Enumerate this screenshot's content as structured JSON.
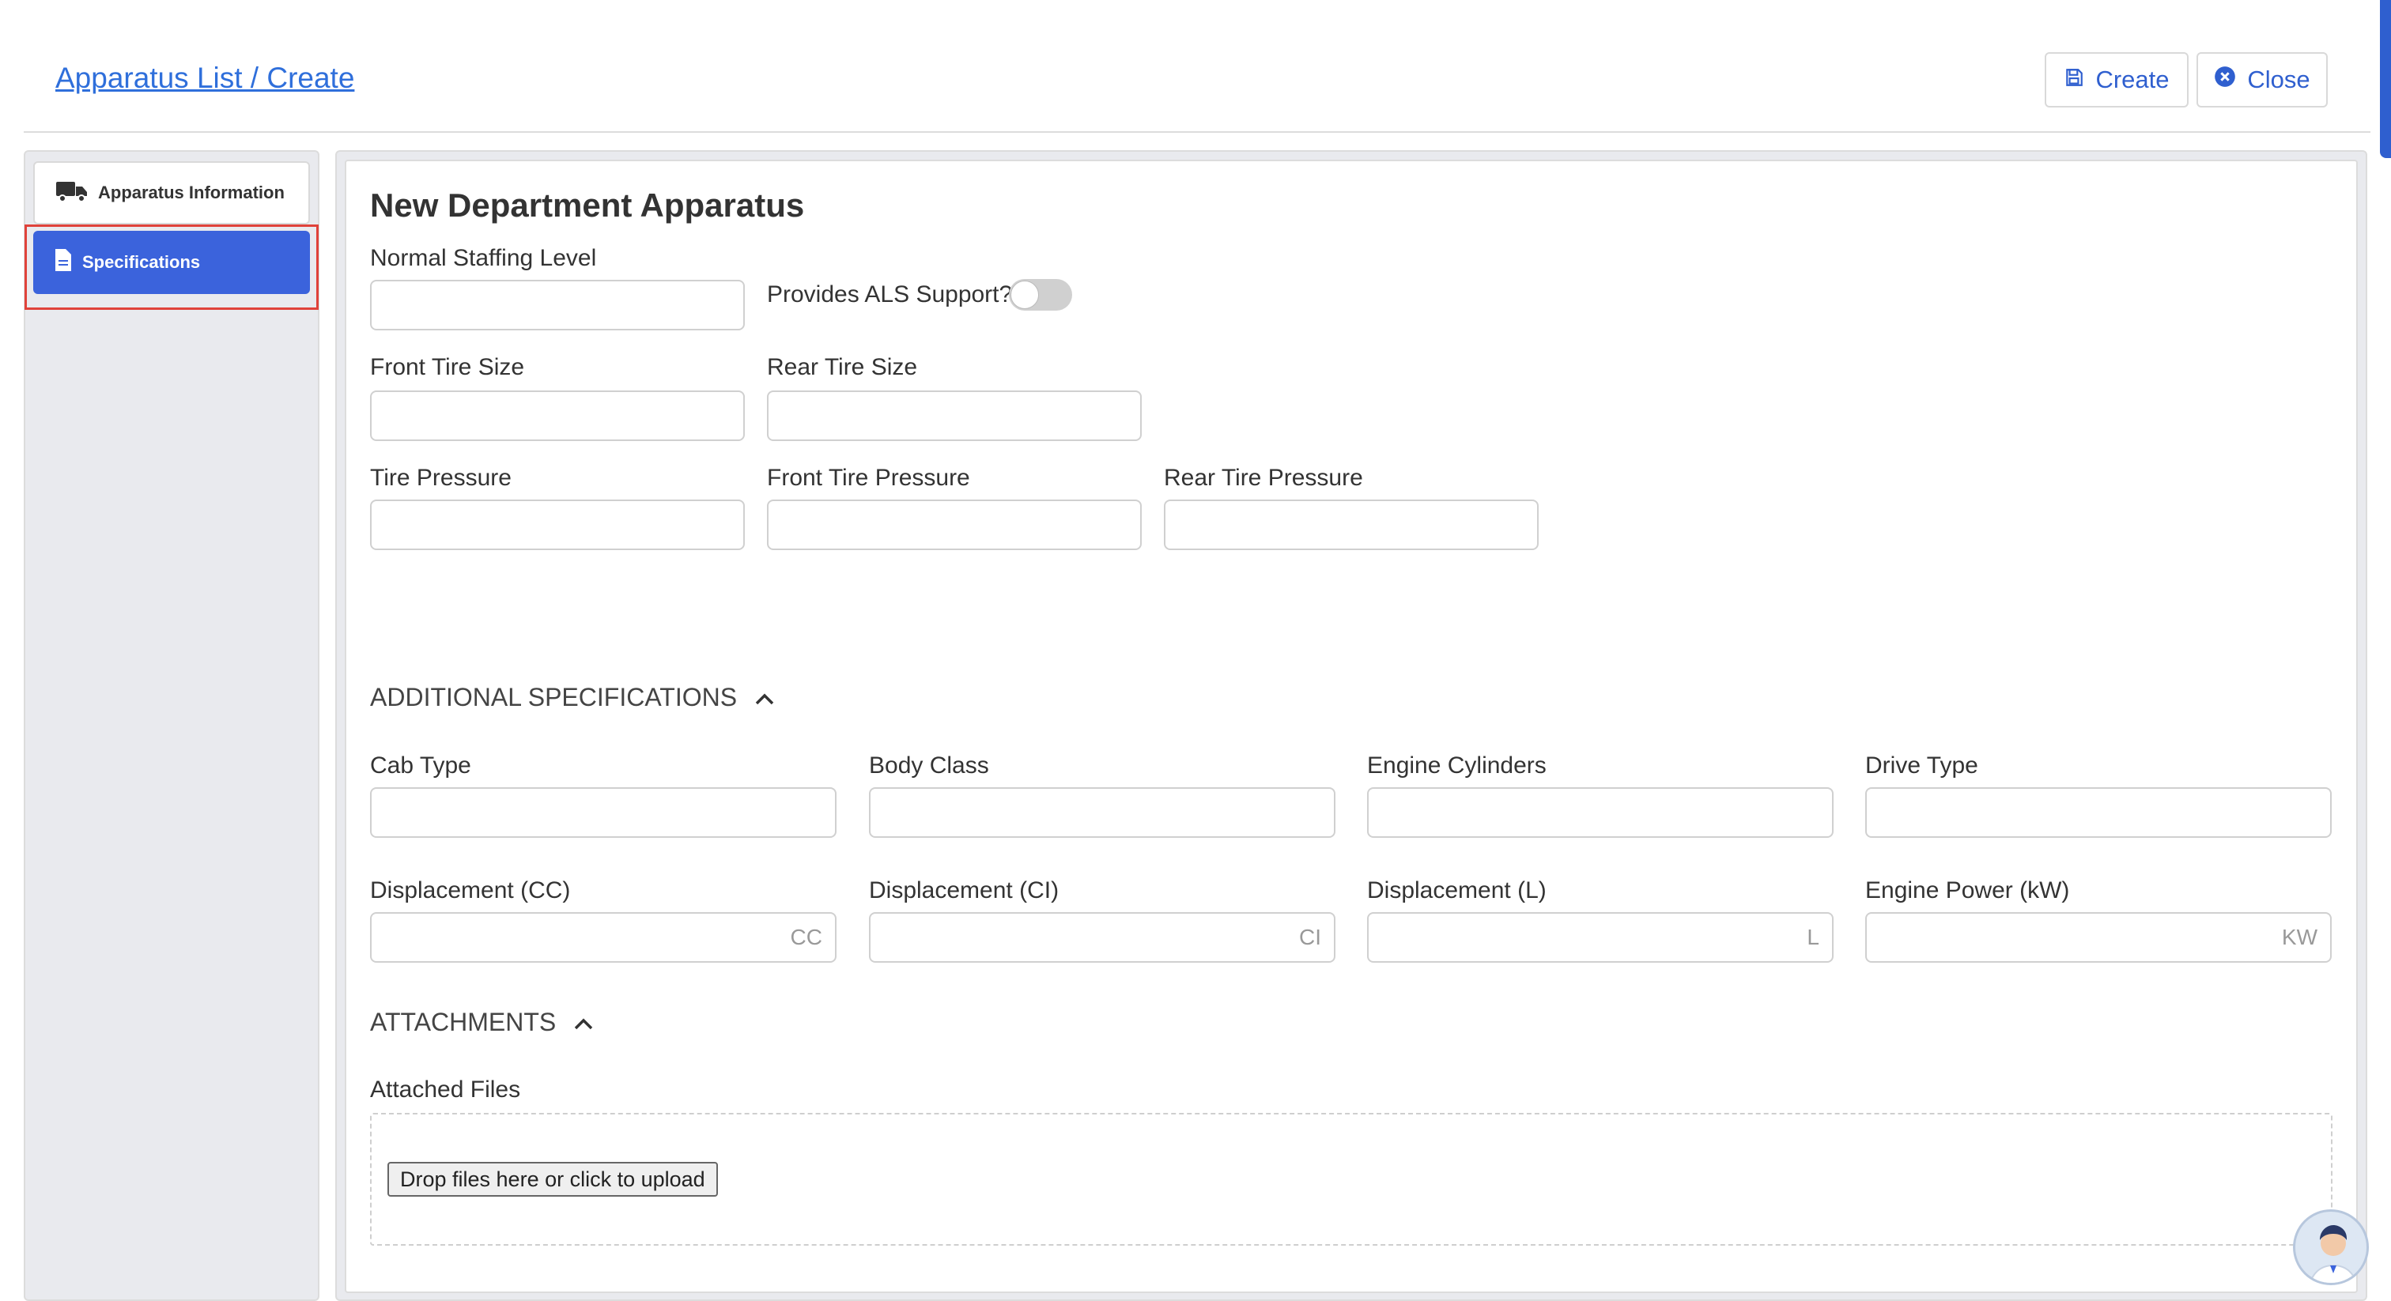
{
  "header": {
    "breadcrumb": "Apparatus List / Create",
    "create_label": "Create",
    "close_label": "Close"
  },
  "sidebar": {
    "items": [
      {
        "label": "Apparatus Information",
        "icon": "truck-icon",
        "active": false
      },
      {
        "label": "Specifications",
        "icon": "document-icon",
        "active": true
      }
    ]
  },
  "form": {
    "title": "New Department Apparatus",
    "normal_staffing_level": {
      "label": "Normal Staffing Level",
      "value": ""
    },
    "als_support": {
      "label": "Provides ALS Support?",
      "value": false
    },
    "front_tire_size": {
      "label": "Front Tire Size",
      "value": ""
    },
    "rear_tire_size": {
      "label": "Rear Tire Size",
      "value": ""
    },
    "tire_pressure": {
      "label": "Tire Pressure",
      "value": ""
    },
    "front_tire_pressure": {
      "label": "Front Tire Pressure",
      "value": ""
    },
    "rear_tire_pressure": {
      "label": "Rear Tire Pressure",
      "value": ""
    }
  },
  "additional": {
    "title": "ADDITIONAL SPECIFICATIONS",
    "cab_type": {
      "label": "Cab Type",
      "value": ""
    },
    "body_class": {
      "label": "Body Class",
      "value": ""
    },
    "engine_cylinders": {
      "label": "Engine Cylinders",
      "value": ""
    },
    "drive_type": {
      "label": "Drive Type",
      "value": ""
    },
    "displacement_cc": {
      "label": "Displacement (CC)",
      "placeholder": "CC",
      "value": ""
    },
    "displacement_ci": {
      "label": "Displacement (CI)",
      "placeholder": "CI",
      "value": ""
    },
    "displacement_l": {
      "label": "Displacement (L)",
      "placeholder": "L",
      "value": ""
    },
    "engine_power_kw": {
      "label": "Engine Power (kW)",
      "placeholder": "KW",
      "value": ""
    }
  },
  "attachments": {
    "title": "ATTACHMENTS",
    "files_label": "Attached Files",
    "upload_label": "Drop files here or click to upload"
  },
  "colors": {
    "accent": "#3b63dc",
    "link": "#2f6fdb",
    "highlight_outline": "#e0423a"
  }
}
